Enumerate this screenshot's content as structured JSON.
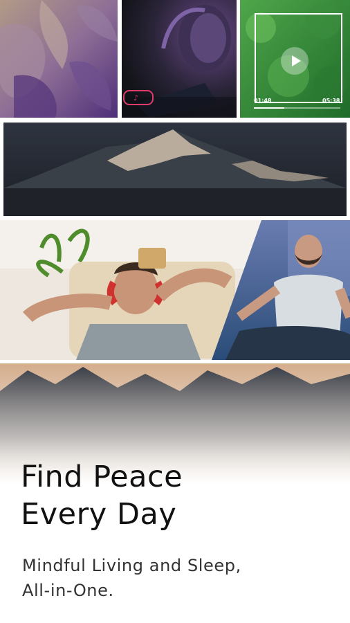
{
  "headline": {
    "line1": "Find Peace",
    "line2": "Every Day"
  },
  "subline": {
    "line1": "Mindful Living and Sleep,",
    "line2": "All-in-One."
  },
  "video_player": {
    "elapsed": "01:48",
    "total": "05:38",
    "progress": 0.35
  },
  "colors": {
    "headline": "#111111",
    "subline": "#333333",
    "video_green": "#2e7d32"
  },
  "icons": [
    "music-note-icon",
    "play-icon"
  ]
}
